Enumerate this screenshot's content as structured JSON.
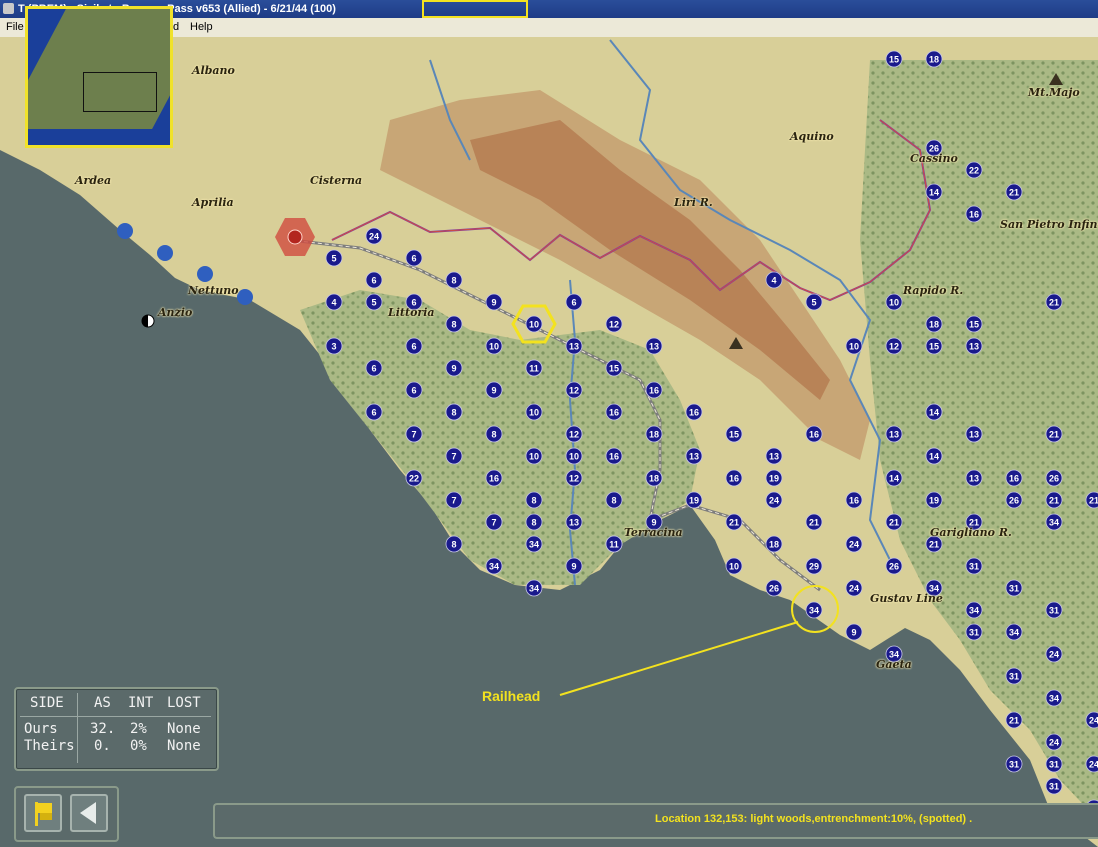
{
  "window": {
    "title": "T                    (PBEM) - Sicily to Brenner Pass v653 (Allied) - 6/21/44 (100)"
  },
  "menu": {
    "file": "File",
    "help": "Help",
    "stub": "d"
  },
  "colors": {
    "accent": "#f3e21f",
    "counter_fill": "#1a1a8c",
    "enemy": "#d14b40"
  },
  "towns": [
    "Albano",
    "Ardea",
    "Cisterna",
    "Aprilia",
    "Nettuno",
    "Anzio",
    "Littoria",
    "Liri R.",
    "Aquino",
    "Cassino",
    "Mt.Majo",
    "San Pietro Infine",
    "Rapido R.",
    "Terracina",
    "Garigliano R.",
    "Gustav Line",
    "Gaeta"
  ],
  "annotation": {
    "railhead": "Railhead"
  },
  "side_table": {
    "headers": [
      "SIDE",
      "AS",
      "INT",
      "LOST"
    ],
    "rows": [
      {
        "side": "Ours",
        "as": "32.",
        "int": "2%",
        "lost": "None"
      },
      {
        "side": "Theirs",
        "as": "0.",
        "int": "0%",
        "lost": "None"
      }
    ]
  },
  "buttons": {
    "flag_icon": "flag-icon",
    "back_icon": "back-arrow-icon"
  },
  "status": {
    "message": "Location 132,153: light woods,entrenchment:10%, (spotted) ."
  },
  "counters": [
    "4",
    "6",
    "8",
    "9",
    "10",
    "6",
    "12",
    "13",
    "13",
    "4",
    "5",
    "10",
    "12",
    "18",
    "18",
    "5",
    "6",
    "5",
    "4",
    "6",
    "6",
    "8",
    "10",
    "13",
    "15",
    "16",
    "7",
    "8",
    "12",
    "15",
    "15",
    "13",
    "3",
    "6",
    "9",
    "11",
    "12",
    "16",
    "8",
    "10",
    "15",
    "22",
    "16",
    "5",
    "6",
    "9",
    "10",
    "16",
    "14",
    "15",
    "13",
    "10",
    "13",
    "15",
    "21",
    "6",
    "8",
    "8",
    "10",
    "12",
    "16",
    "18",
    "16",
    "13",
    "16",
    "13",
    "16",
    "21",
    "7",
    "7",
    "10",
    "12",
    "18",
    "13",
    "13",
    "14",
    "14",
    "13",
    "14",
    "16",
    "13",
    "22",
    "16",
    "7",
    "6",
    "8",
    "9",
    "16",
    "19",
    "19",
    "21",
    "16",
    "21",
    "19",
    "26",
    "14",
    "8",
    "7",
    "8",
    "13",
    "13",
    "21",
    "24",
    "18",
    "21",
    "26",
    "21",
    "21",
    "21",
    "34",
    "8",
    "11",
    "18",
    "26",
    "24",
    "26",
    "34",
    "31",
    "34",
    "34",
    "9",
    "10",
    "26",
    "29",
    "24",
    "34",
    "31",
    "31",
    "34",
    "34",
    "9",
    "31",
    "34",
    "34",
    "24",
    "31",
    "34",
    "31",
    "21",
    "31",
    "24",
    "24",
    "24",
    "24",
    "26",
    "31",
    "26",
    "21",
    "24"
  ]
}
